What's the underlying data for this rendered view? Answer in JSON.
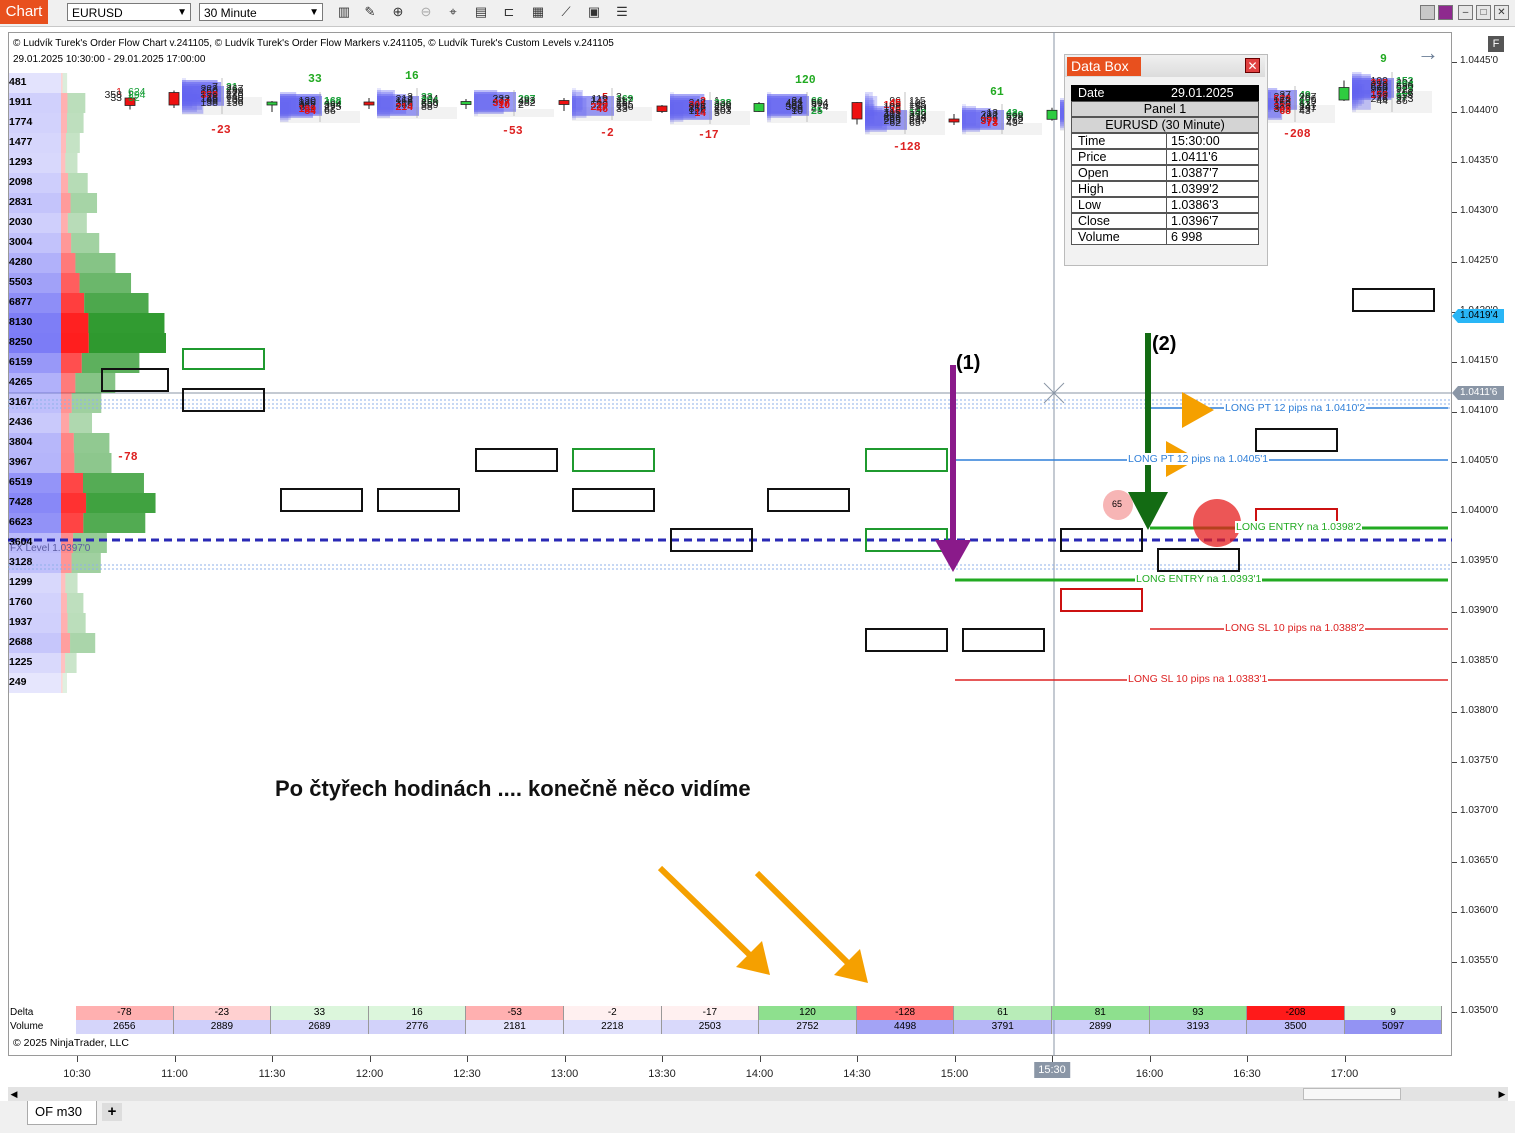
{
  "toolbar": {
    "chart_tab": "Chart",
    "instrument": "EURUSD",
    "interval": "30 Minute",
    "icons": [
      "bar-type-icon",
      "draw-pencil-icon",
      "zoom-in-icon",
      "zoom-out-icon",
      "crosshair-icon",
      "data-box-icon",
      "template-icon",
      "indicators-icon",
      "strategies-icon",
      "properties-icon",
      "menu-icon"
    ]
  },
  "header": {
    "line1": "© Ludvík Turek's Order Flow Chart v.241105, © Ludvík Turek's Order Flow Markers v.241105, © Ludvík Turek's Custom Levels v.241105",
    "line2": "29.01.2025 10:30:00 - 29.01.2025 17:00:00"
  },
  "copyright": "© 2025 NinjaTrader, LLC",
  "annotation_text": "Po čtyřech hodinách .... konečně něco vidíme",
  "marker_labels": {
    "m1": "(1)",
    "m2": "(2)"
  },
  "fx_level_label": "FX Level 1.0397'0",
  "price_axis": {
    "labels": [
      "1.0445'0",
      "1.0440'0",
      "1.0435'0",
      "1.0430'0",
      "1.0425'0",
      "1.0420'0",
      "1.0415'0",
      "1.0410'0",
      "1.0405'0",
      "1.0400'0",
      "1.0395'0",
      "1.0390'0",
      "1.0385'0",
      "1.0380'0",
      "1.0375'0",
      "1.0370'0",
      "1.0365'0",
      "1.0360'0",
      "1.0355'0",
      "1.0350'0"
    ],
    "last_price": "1.0419'4",
    "crosshair_price": "1.0411'6",
    "last_price_color": "#29b6f6"
  },
  "time_axis": {
    "labels": [
      "10:30",
      "11:00",
      "11:30",
      "12:00",
      "12:30",
      "13:00",
      "13:30",
      "14:00",
      "14:30",
      "15:00",
      "15:30",
      "16:00",
      "16:30",
      "17:00"
    ],
    "highlight": "15:30"
  },
  "volume_profile": {
    "values": [
      "481",
      "1911",
      "1774",
      "1477",
      "1293",
      "2098",
      "2831",
      "2030",
      "3004",
      "4280",
      "5503",
      "6877",
      "8130",
      "8250",
      "6159",
      "4265",
      "3167",
      "2436",
      "3804",
      "3967",
      "6519",
      "7428",
      "6623",
      "3604",
      "3128",
      "1299",
      "1760",
      "1937",
      "2688",
      "1225",
      "249"
    ]
  },
  "data_box": {
    "title": "Data Box",
    "date_label": "Date",
    "date_value": "29.01.2025",
    "panel": "Panel 1",
    "instrument": "EURUSD (30 Minute)",
    "rows": [
      {
        "k": "Time",
        "v": "15:30:00"
      },
      {
        "k": "Price",
        "v": "1.0411'6"
      },
      {
        "k": "Open",
        "v": "1.0387'7"
      },
      {
        "k": "High",
        "v": "1.0399'2"
      },
      {
        "k": "Low",
        "v": "1.0386'3"
      },
      {
        "k": "Close",
        "v": "1.0396'7"
      },
      {
        "k": "Volume",
        "v": "6 998"
      }
    ]
  },
  "strategy_labels": {
    "pt1": "LONG PT 12 pips na 1.0410'2",
    "pt2": "LONG PT 12 pips na 1.0405'1",
    "entry1": "LONG ENTRY na 1.0398'2",
    "entry2": "LONG ENTRY na 1.0393'1",
    "sl1": "LONG SL 10 pips na 1.0388'2",
    "sl2": "LONG SL 10 pips na 1.0383'1"
  },
  "summary": {
    "delta_label": "Delta",
    "volume_label": "Volume",
    "delta": [
      "-78",
      "-23",
      "33",
      "16",
      "-53",
      "-2",
      "-17",
      "120",
      "-128",
      "61",
      "81",
      "93",
      "-208",
      "9"
    ],
    "volume": [
      "2656",
      "2889",
      "2689",
      "2776",
      "2181",
      "2218",
      "2503",
      "2752",
      "4498",
      "3791",
      "2899",
      "3193",
      "3500",
      "5097"
    ]
  },
  "chart_data": {
    "type": "candlestick-footprint",
    "instrument": "EURUSD",
    "interval": "30 Minute",
    "bars": [
      {
        "time": "11:00",
        "open": 1.0409,
        "close": 1.04015,
        "high": 1.04165,
        "low": 1.03975,
        "delta": "-78",
        "cells": [
          [
            1,
            "624",
            1.0414
          ],
          [
            358,
            "294",
            1.0411
          ],
          [
            33,
            "32",
            1.0408
          ]
        ]
      },
      {
        "time": "11:00",
        "open": 1.04145,
        "close": 1.0402,
        "high": 1.04165,
        "low": 1.0399,
        "delta": "-23",
        "cells": [
          [
            7,
            "21",
            1.0419
          ],
          [
            223,
            "267",
            1.0417
          ],
          [
            250,
            "289",
            1.0415
          ],
          [
            158,
            "178",
            1.0413
          ],
          [
            339,
            "240",
            1.0411
          ],
          [
            78,
            "64",
            1.0409
          ],
          [
            145,
            "130",
            1.0407
          ],
          [
            98,
            "108",
            1.0405
          ],
          [
            158,
            "136",
            1.0403
          ]
        ]
      },
      {
        "time": "11:30",
        "open": 1.04045,
        "close": 1.0405,
        "high": 1.0406,
        "low": 1.0395,
        "delta": "33",
        "cells": [
          [
            120,
            "168",
            1.0405
          ],
          [
            326,
            "406",
            1.0403
          ],
          [
            382,
            "364",
            1.0401
          ],
          [
            311,
            "275",
            1.0399
          ],
          [
            109,
            "82",
            1.0397
          ],
          [
            84,
            "66",
            1.0395
          ]
        ]
      },
      {
        "time": "12:00",
        "open": 1.0405,
        "close": 1.04045,
        "high": 1.0409,
        "low": 1.0398,
        "delta": "16",
        "cells": [
          [
            3,
            "33",
            1.0409
          ],
          [
            212,
            "204",
            1.0407
          ],
          [
            168,
            "204",
            1.0405
          ],
          [
            318,
            "358",
            1.0403
          ],
          [
            465,
            "509",
            1.0401
          ],
          [
            214,
            "88",
            1.0399
          ]
        ]
      },
      {
        "time": "12:30",
        "open": 1.04035,
        "close": 1.04055,
        "high": 1.0408,
        "low": 1.0398,
        "delta": "-53",
        "cells": [
          [
            233,
            "297",
            1.0407
          ],
          [
            477,
            "483",
            1.0405
          ],
          [
            397,
            "282",
            1.0403
          ],
          [
            10,
            "2",
            1.0401
          ]
        ]
      },
      {
        "time": "13:00",
        "open": 1.04065,
        "close": 1.04025,
        "high": 1.0409,
        "low": 1.0396,
        "delta": "-2",
        "cells": [
          [
            5,
            "3",
            1.0409
          ],
          [
            119,
            "169",
            1.0407
          ],
          [
            143,
            "117",
            1.0405
          ],
          [
            44,
            "25",
            1.0403
          ],
          [
            526,
            "585",
            1.0401
          ],
          [
            227,
            "156",
            1.0399
          ],
          [
            46,
            "33",
            1.0397
          ]
        ]
      },
      {
        "time": "13:30",
        "open": 1.0401,
        "close": 1.03955,
        "high": 1.0402,
        "low": 1.0394,
        "delta": "-17",
        "cells": [
          [
            2,
            "1",
            1.0405
          ],
          [
            248,
            "338",
            1.0403
          ],
          [
            301,
            "209",
            1.0401
          ],
          [
            216,
            "226",
            1.0399
          ],
          [
            356,
            "361",
            1.0397
          ],
          [
            124,
            "103",
            1.0395
          ],
          [
            14,
            "5",
            1.0393
          ]
        ]
      },
      {
        "time": "14:00",
        "open": 1.03955,
        "close": 1.04035,
        "high": 1.0405,
        "low": 1.0395,
        "delta": "120",
        "cells": [
          [
            34,
            "66",
            1.0405
          ],
          [
            451,
            "504",
            1.0403
          ],
          [
            482,
            "516",
            1.0401
          ],
          [
            306,
            "274",
            1.0399
          ],
          [
            38,
            "41",
            1.0397
          ],
          [
            10,
            "25",
            1.0395
          ]
        ]
      },
      {
        "time": "14:30",
        "open": 1.04045,
        "close": 1.0388,
        "high": 1.0405,
        "low": 1.03825,
        "delta": "-128",
        "cells": [
          [
            96,
            "115",
            1.0405
          ],
          [
            45,
            "10",
            1.0403
          ],
          [
            185,
            "145",
            1.0401
          ],
          [
            108,
            "116",
            1.0399
          ],
          [
            125,
            "130",
            1.0397
          ],
          [
            46,
            "13",
            1.0395
          ],
          [
            115,
            "140",
            1.0393
          ],
          [
            401,
            "379",
            1.0391
          ],
          [
            236,
            "234",
            1.0389
          ],
          [
            599,
            "538",
            1.0387
          ],
          [
            295,
            "297",
            1.0385
          ],
          [
            62,
            "65",
            1.0383
          ]
        ]
      },
      {
        "time": "15:00",
        "open": 1.0388,
        "close": 1.03875,
        "high": 1.0393,
        "low": 1.0382,
        "delta": "61",
        "cells": [
          [
            13,
            "43",
            1.0393
          ],
          [
            222,
            "269",
            1.0391
          ],
          [
            487,
            "528",
            1.0389
          ],
          [
            699,
            "775",
            1.0387
          ],
          [
            371,
            "262",
            1.0385
          ],
          [
            73,
            "43",
            1.0383
          ]
        ]
      },
      {
        "time": "15:30",
        "open": 1.03877,
        "close": 1.03967,
        "high": 1.03992,
        "low": 1.03863,
        "delta": "81",
        "cells": [
          [
            52,
            "131",
            1.0399
          ],
          [
            392,
            "602",
            1.0397
          ],
          [
            394,
            "304",
            1.0395
          ],
          [
            73,
            "84",
            1.0393
          ],
          [
            122,
            "157",
            1.0391
          ],
          [
            136,
            "193",
            1.0389
          ],
          [
            38,
            "39",
            1.0387
          ]
        ]
      },
      {
        "time": "16:00",
        "open": 1.03975,
        "close": 1.03985,
        "high": 1.04015,
        "low": 1.0393,
        "delta": "93",
        "cells": [
          [
            59,
            "75",
            1.0401
          ],
          [
            320,
            "449",
            1.0399
          ],
          [
            471,
            "582",
            1.0397
          ],
          [
            609,
            "514",
            1.0395
          ],
          [
            91,
            "83",
            1.0393
          ]
        ]
      },
      {
        "time": "16:30",
        "open": 1.04015,
        "close": 1.04075,
        "high": 1.0412,
        "low": 1.0395,
        "delta": "-208",
        "cells": [
          [
            37,
            "49",
            1.0411
          ],
          [
            224,
            "267",
            1.0409
          ],
          [
            523,
            "406",
            1.0407
          ],
          [
            178,
            "175",
            1.0405
          ],
          [
            64,
            "81",
            1.0403
          ],
          [
            119,
            "137",
            1.0401
          ],
          [
            336,
            "241",
            1.0399
          ],
          [
            303,
            "297",
            1.0397
          ],
          [
            68,
            "43",
            1.0395
          ]
        ]
      },
      {
        "time": "17:00",
        "open": 1.0407,
        "close": 1.04195,
        "high": 1.04265,
        "low": 1.0406,
        "delta": "9",
        "cells": [
          [
            109,
            "153",
            1.0425
          ],
          [
            313,
            "204",
            1.0423
          ],
          [
            229,
            "294",
            1.0421
          ],
          [
            576,
            "580",
            1.0419
          ],
          [
            560,
            "523",
            1.0417
          ],
          [
            74,
            "112",
            1.0415
          ],
          [
            165,
            "168",
            1.0413
          ],
          [
            156,
            "113",
            1.0411
          ],
          [
            72,
            "97",
            1.0409
          ],
          [
            246,
            "273",
            1.0407
          ],
          [
            44,
            "36",
            1.0405
          ]
        ]
      }
    ]
  },
  "bottom_tab": "OF m30",
  "add_tab": "+",
  "colors": {
    "bull": "#2ecc40",
    "bear": "#ee1111",
    "delta_pos": "#22aa22",
    "delta_neg": "#dd2222",
    "fx_level": "#2a2ab5"
  }
}
